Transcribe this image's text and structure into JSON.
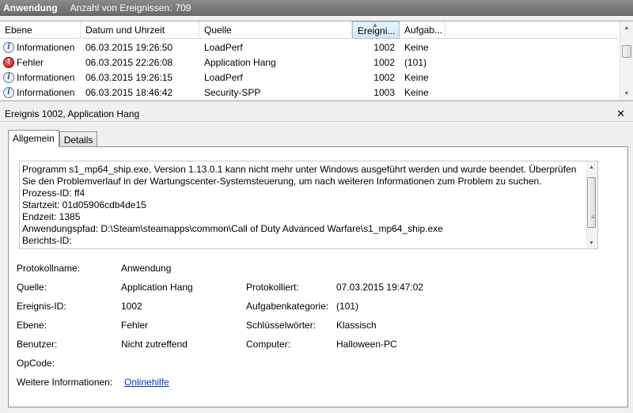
{
  "header": {
    "log_name": "Anwendung",
    "count_label": "Anzahl von Ereignissen:",
    "count": "709"
  },
  "columns": {
    "ebene": "Ebene",
    "datum": "Datum und Uhrzeit",
    "quelle": "Quelle",
    "id": "Ereigni...",
    "aufgabe": "Aufgab..."
  },
  "events": [
    {
      "level": "Informationen",
      "icon": "info-icon",
      "date": "06.03.2015 19:26:50",
      "source": "LoadPerf",
      "id": "1002",
      "task": "Keine"
    },
    {
      "level": "Fehler",
      "icon": "error-icon",
      "date": "06.03.2015 22:26:08",
      "source": "Application Hang",
      "id": "1002",
      "task": "(101)"
    },
    {
      "level": "Informationen",
      "icon": "info-icon",
      "date": "06.03.2015 19:26:15",
      "source": "LoadPerf",
      "id": "1002",
      "task": "Keine"
    },
    {
      "level": "Informationen",
      "icon": "info-icon",
      "date": "06.03.2015 18:46:42",
      "source": "Security-SPP",
      "id": "1003",
      "task": "Keine"
    }
  ],
  "detail": {
    "title": "Ereignis 1002, Application Hang",
    "close_glyph": "✕",
    "tabs": [
      "Allgemein",
      "Details"
    ],
    "description": {
      "line1": "Programm s1_mp64_ship.exe, Version 1.13.0.1 kann nicht mehr unter Windows ausgeführt werden und wurde beendet. Überprüfen Sie den Problemverlauf in der Wartungscenter-Systemsteuerung, um nach weiteren Informationen zum Problem zu suchen.",
      "process_id": "Prozess-ID: ff4",
      "start_time": "Startzeit: 01d05906cdb4de15",
      "end_time": "Endzeit: 1385",
      "app_path": "Anwendungspfad: D:\\Steam\\steamapps\\common\\Call of Duty Advanced Warfare\\s1_mp64_ship.exe",
      "report_id": "Berichts-ID:"
    },
    "props": {
      "protokollname_label": "Protokollname:",
      "protokollname": "Anwendung",
      "quelle_label": "Quelle:",
      "quelle": "Application Hang",
      "protokolliert_label": "Protokolliert:",
      "protokolliert": "07.03.2015 19:47:02",
      "ereignis_id_label": "Ereignis-ID:",
      "ereignis_id": "1002",
      "aufgabenkategorie_label": "Aufgabenkategorie:",
      "aufgabenkategorie": "(101)",
      "ebene_label": "Ebene:",
      "ebene": "Fehler",
      "schluessel_label": "Schlüsselwörter:",
      "schluessel": "Klassisch",
      "benutzer_label": "Benutzer:",
      "benutzer": "Nicht zutreffend",
      "computer_label": "Computer:",
      "computer": "Halloween-PC",
      "opcode_label": "OpCode:",
      "weitere_label": "Weitere Informationen:",
      "weitere_link": "Onlinehilfe"
    }
  }
}
